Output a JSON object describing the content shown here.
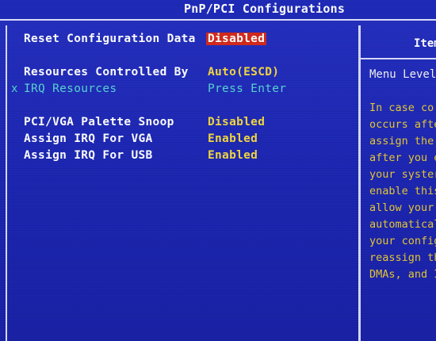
{
  "screen": {
    "title": "PnP/PCI Configurations"
  },
  "settings": [
    {
      "label": "Reset Configuration Data",
      "value": "Disabled",
      "selected": true
    },
    {
      "label": "Resources Controlled By",
      "value": "Auto(ESCD)"
    },
    {
      "label": "IRQ Resources",
      "value": "Press Enter",
      "marker": "x",
      "disabled": true
    },
    {
      "label": "PCI/VGA Palette Snoop",
      "value": "Disabled"
    },
    {
      "label": "Assign IRQ For VGA",
      "value": "Enabled"
    },
    {
      "label": "Assign IRQ For USB",
      "value": "Enabled"
    }
  ],
  "help": {
    "title": "Item",
    "level": "Menu Level",
    "lines": [
      "In case co",
      "occurs afte",
      "assign the",
      "after you e",
      "your syster",
      "enable this",
      "allow your",
      "automatical",
      "your config",
      "reassign th",
      "DMAs, and I"
    ]
  },
  "colors": {
    "background": "#1c26b0",
    "label": "#ffffff",
    "value": "#f3d840",
    "disabled": "#5ad4d4",
    "highlight": "#d42a1c",
    "help_text": "#e6c832"
  }
}
